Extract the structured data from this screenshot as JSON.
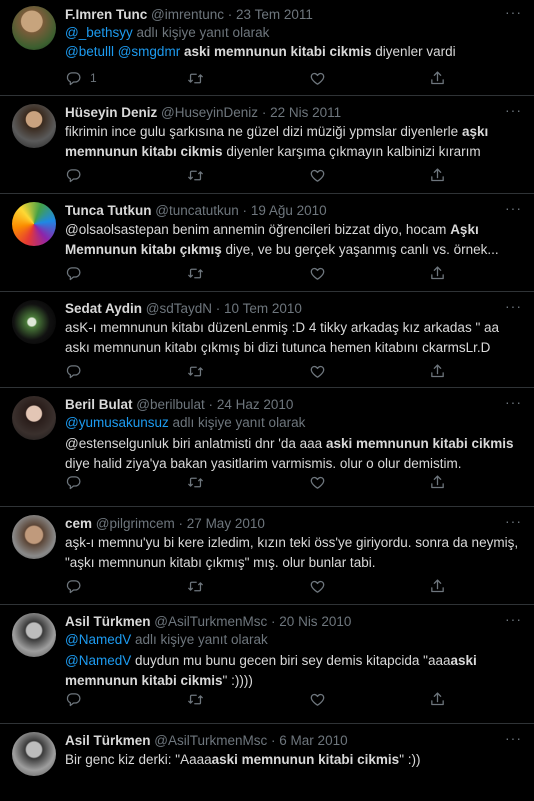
{
  "tweets": [
    {
      "name": "F.Imren Tunc",
      "handle": "@imrentunc",
      "sep": "·",
      "date": "23 Tem 2011",
      "reply_to": "@_bethsyy",
      "reply_suffix": "adlı kişiye yanıt olarak",
      "text_1": "@betulll @smgdmr",
      "text_2": "aski memnunun kitabi cikmis",
      "text_3": "diyenler vardi",
      "reply_count": "1"
    },
    {
      "name": "Hüseyin Deniz",
      "handle": "@HuseyinDeniz",
      "sep": "·",
      "date": "22 Nis 2011",
      "text_1": "fikrimin ince gulu şarkısına ne güzel dizi müziği ypmslar diyenlerle",
      "text_2": "aşkı memnunun kitabı cikmis",
      "text_3": "diyenler karşıma çıkmayın kalbinizi kırarım"
    },
    {
      "name": "Tunca Tutkun",
      "handle": "@tuncatutkun",
      "sep": "·",
      "date": "19 Ağu 2010",
      "text_1": "@olsaolsastepan benim annemin öğrencileri bizzat diyo, hocam",
      "text_2": "Aşkı Memnunun kitabı çıkmış",
      "text_3": "diye, ve bu gerçek yaşanmış canlı vs. örnek..."
    },
    {
      "name": "Sedat Aydin",
      "handle": "@sdTaydN",
      "sep": "·",
      "date": "10 Tem 2010",
      "text_1": "asK-ı memnunun kitabı düzenLenmiş :D 4 tikky arkadaş kız arkadas \" aa askı memnunun kitabı çıkmış bi dizi tutunca hemen kitabını ckarmsLr.D"
    },
    {
      "name": "Beril Bulat",
      "handle": "@berilbulat",
      "sep": "·",
      "date": "24 Haz 2010",
      "reply_to": "@yumusakunsuz",
      "reply_suffix": "adlı kişiye yanıt olarak",
      "text_1": "@estenselgunluk biri anlatmisti dnr 'da aaa",
      "text_2": "aski memnunun kitabi cikmis",
      "text_3": "diye halid ziya'ya bakan yasitlarim varmismis. olur o olur demistim."
    },
    {
      "name": "cem",
      "handle": "@pilgrimcem",
      "sep": "·",
      "date": "27 May 2010",
      "text_1": "aşk-ı memnu'yu bi kere izledim, kızın teki öss'ye giriyordu. sonra da neymiş, \"aşkı memnunun kitabı çıkmış\" mış. olur bunlar tabi."
    },
    {
      "name": "Asil Türkmen",
      "handle": "@AsilTurkmenMsc",
      "sep": "·",
      "date": "20 Nis 2010",
      "reply_to": "@NamedV",
      "reply_suffix": "adlı kişiye yanıt olarak",
      "text_1": "@NamedV",
      "text_2": "duydun mu bunu gecen biri sey demis kitapcida \"aaa",
      "text_3": "aski memnunun kitabi cikmis",
      "text_4": "\" :))))"
    },
    {
      "name": "Asil Türkmen",
      "handle": "@AsilTurkmenMsc",
      "sep": "·",
      "date": "6 Mar 2010",
      "text_1": "Bir genc kiz derki: \"Aaaa",
      "text_2": "aski memnunun kitabi cikmis",
      "text_3": "\" :))"
    }
  ],
  "more_glyph": "···",
  "icons": [
    "reply-icon",
    "retweet-icon",
    "like-icon",
    "share-icon",
    "more-icon"
  ],
  "colors": {
    "background": "#000000",
    "link": "#1d9bf0",
    "muted": "#6e767d",
    "text": "#d9d9d9",
    "divider": "#2f3336"
  }
}
